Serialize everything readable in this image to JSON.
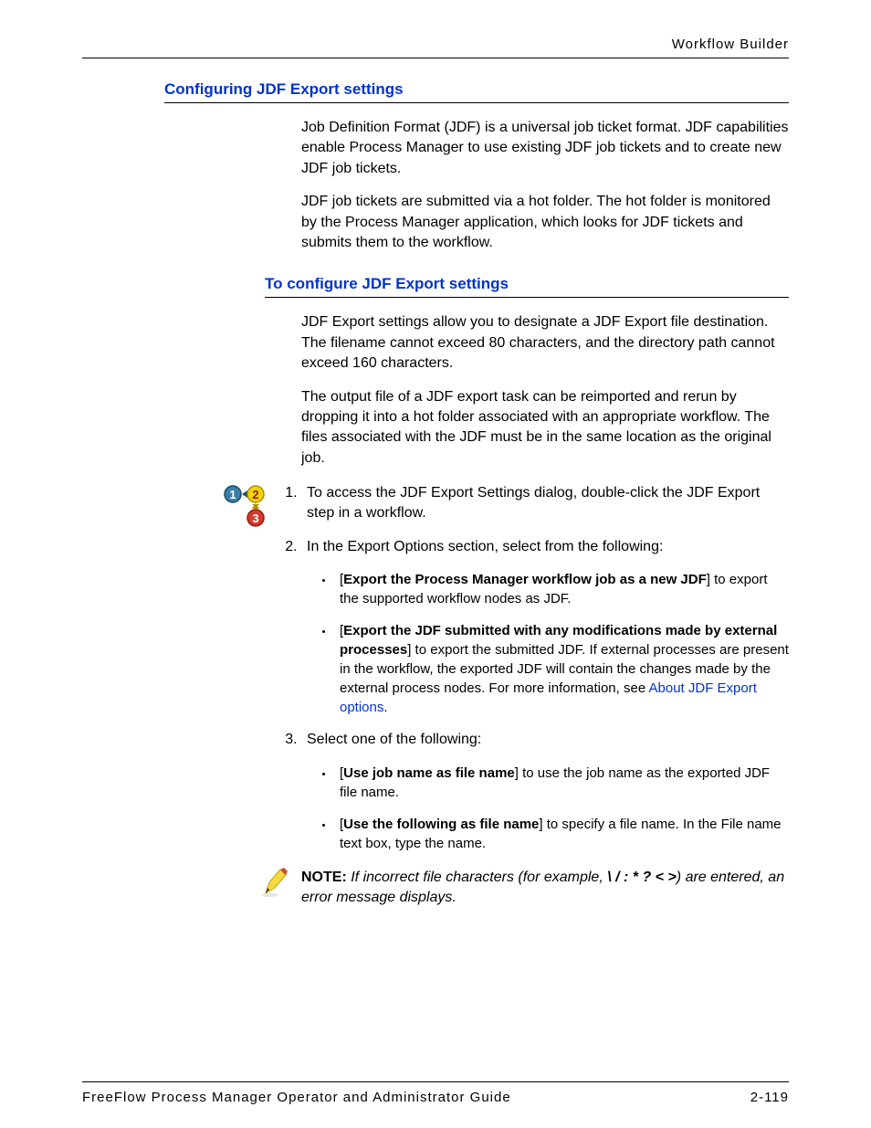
{
  "header": {
    "title": "Workflow Builder"
  },
  "section1": {
    "heading": "Configuring JDF Export settings",
    "p1": "Job Definition Format (JDF) is a universal job ticket format. JDF capabilities enable Process Manager to use existing JDF job tickets and to create new JDF job tickets.",
    "p2": "JDF job tickets are submitted via a hot folder. The hot folder is monitored by the Process Manager application, which looks for JDF tickets and submits them to the workflow."
  },
  "section2": {
    "heading": "To configure JDF Export settings",
    "p1": "JDF Export settings allow you to designate a JDF Export file destination. The filename cannot exceed 80 characters, and the directory path cannot exceed 160 characters.",
    "p2": "The output file of a JDF export task can be reimported and rerun by dropping it into a hot folder associated with an appropriate workflow. The files associated with the JDF must be in the same location as the original job.",
    "step1": "To access the JDF Export Settings dialog, double-click the JDF Export step in a workflow.",
    "step2": "In the Export Options section, select from the following:",
    "step2_bullet1_bold": "Export the Process Manager workflow job as a new JDF",
    "step2_bullet1_rest": "] to export the supported workflow nodes as JDF.",
    "step2_bullet2_bold": "Export the JDF submitted with any modifications made by external processes",
    "step2_bullet2_rest": "] to export the submitted JDF. If external processes are present in the workflow, the exported JDF will contain the changes made by the external process nodes. For more information, see ",
    "step2_bullet2_link": "About JDF Export options",
    "step3": "Select one of the following:",
    "step3_bullet1_bold": "Use job name as file name",
    "step3_bullet1_rest": "] to use the job name as the exported JDF file name.",
    "step3_bullet2_bold": "Use the following as file name",
    "step3_bullet2_rest": "] to specify a file name. In the File name text box, type the name."
  },
  "note": {
    "label": "NOTE:",
    "text_pre": "If incorrect file characters (for example, ",
    "chars": "\\ / : * ? < >",
    "text_post": ") are entered, an error message displays."
  },
  "footer": {
    "left": "FreeFlow Process Manager Operator and Administrator Guide",
    "right": "2-119"
  }
}
